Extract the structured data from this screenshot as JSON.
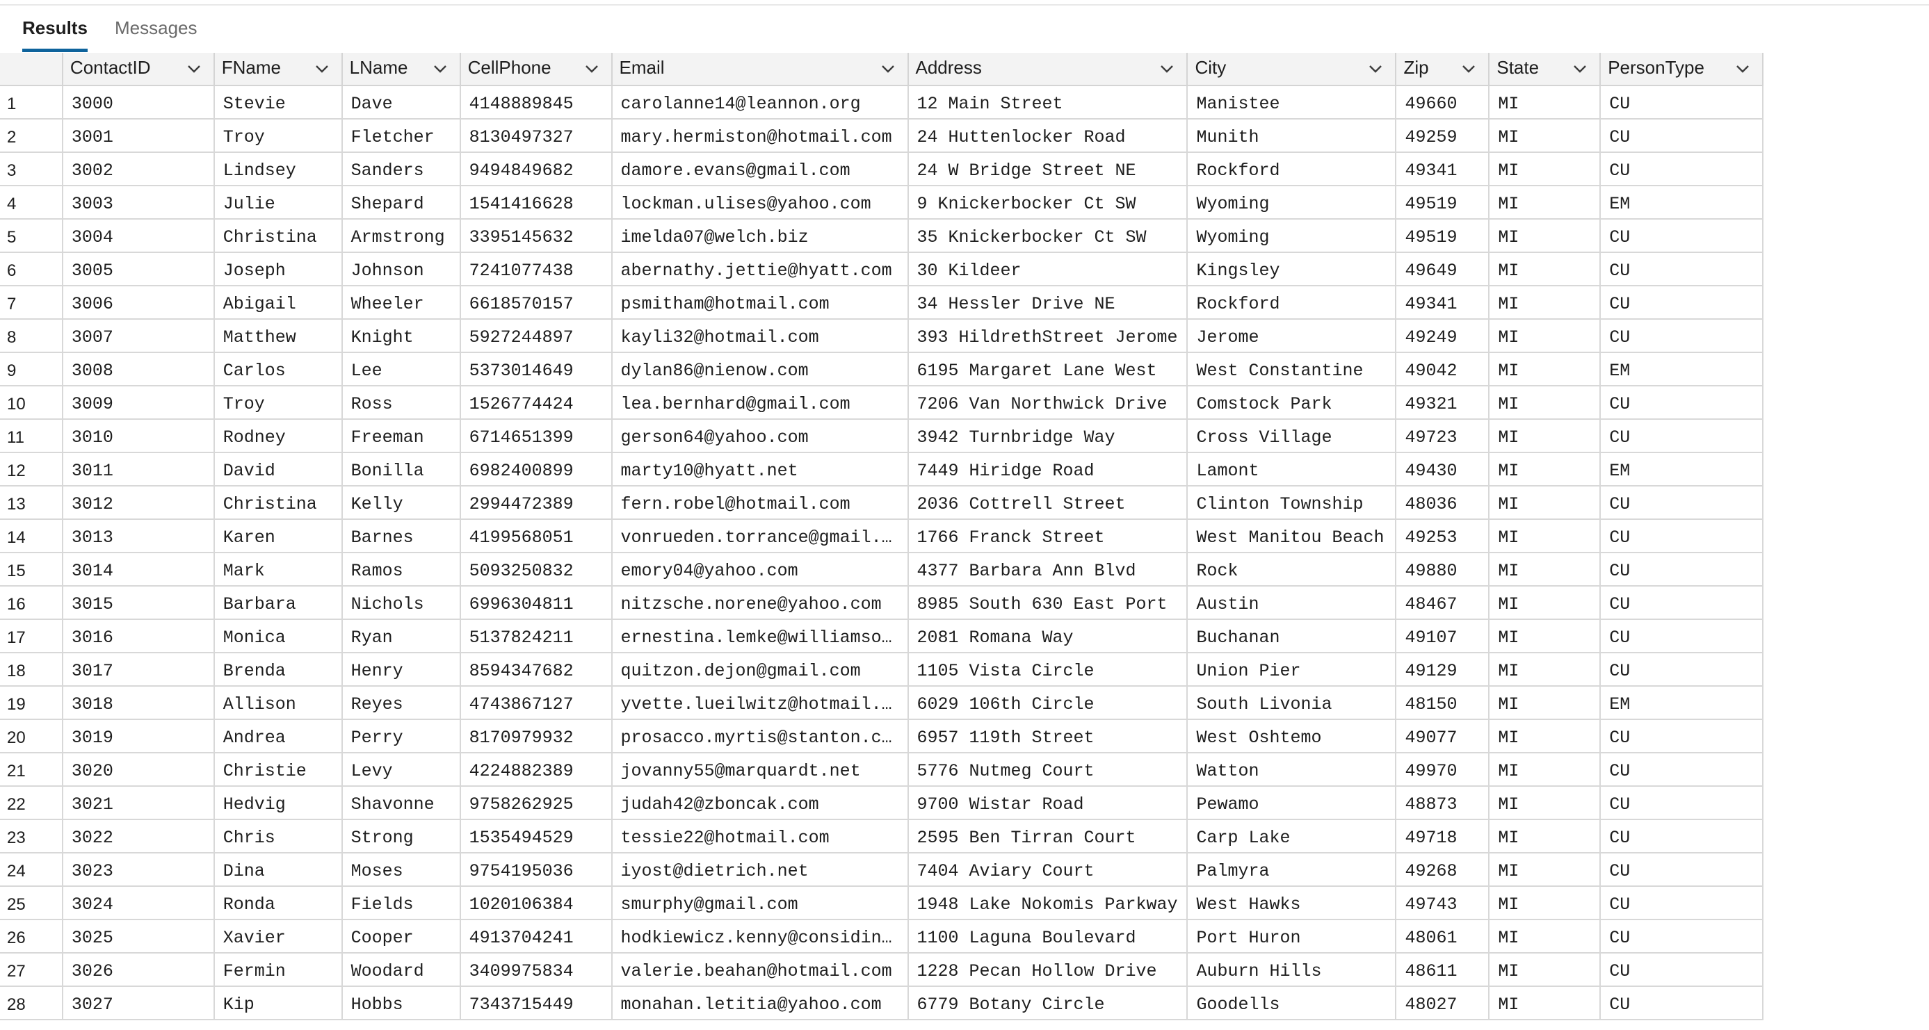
{
  "tabs": [
    {
      "label": "Results",
      "active": true
    },
    {
      "label": "Messages",
      "active": false
    }
  ],
  "columns": [
    "ContactID",
    "FName",
    "LName",
    "CellPhone",
    "Email",
    "Address",
    "City",
    "Zip",
    "State",
    "PersonType"
  ],
  "rows": [
    [
      "1",
      "3000",
      "Stevie",
      "Dave",
      "4148889845",
      "carolanne14@leannon.org",
      "12 Main Street",
      "Manistee",
      "49660",
      "MI",
      "CU"
    ],
    [
      "2",
      "3001",
      "Troy",
      "Fletcher",
      "8130497327",
      "mary.hermiston@hotmail.com",
      "24 Huttenlocker Road",
      "Munith",
      "49259",
      "MI",
      "CU"
    ],
    [
      "3",
      "3002",
      "Lindsey",
      "Sanders",
      "9494849682",
      "damore.evans@gmail.com",
      "24 W Bridge Street NE",
      "Rockford",
      "49341",
      "MI",
      "CU"
    ],
    [
      "4",
      "3003",
      "Julie",
      "Shepard",
      "1541416628",
      "lockman.ulises@yahoo.com",
      "9 Knickerbocker Ct SW",
      "Wyoming",
      "49519",
      "MI",
      "EM"
    ],
    [
      "5",
      "3004",
      "Christina",
      "Armstrong",
      "3395145632",
      "imelda07@welch.biz",
      "35 Knickerbocker Ct SW",
      "Wyoming",
      "49519",
      "MI",
      "CU"
    ],
    [
      "6",
      "3005",
      "Joseph",
      "Johnson",
      "7241077438",
      "abernathy.jettie@hyatt.com",
      "30 Kildeer",
      "Kingsley",
      "49649",
      "MI",
      "CU"
    ],
    [
      "7",
      "3006",
      "Abigail",
      "Wheeler",
      "6618570157",
      "psmitham@hotmail.com",
      "34 Hessler Drive NE",
      "Rockford",
      "49341",
      "MI",
      "CU"
    ],
    [
      "8",
      "3007",
      "Matthew",
      "Knight",
      "5927244897",
      "kayli32@hotmail.com",
      "393 HildrethStreet Jerome",
      "Jerome",
      "49249",
      "MI",
      "CU"
    ],
    [
      "9",
      "3008",
      "Carlos",
      "Lee",
      "5373014649",
      "dylan86@nienow.com",
      "6195 Margaret Lane West",
      "West Constantine",
      "49042",
      "MI",
      "EM"
    ],
    [
      "10",
      "3009",
      "Troy",
      "Ross",
      "1526774424",
      "lea.bernhard@gmail.com",
      "7206 Van Northwick Drive",
      "Comstock Park",
      "49321",
      "MI",
      "CU"
    ],
    [
      "11",
      "3010",
      "Rodney",
      "Freeman",
      "6714651399",
      "gerson64@yahoo.com",
      "3942 Turnbridge Way",
      "Cross Village",
      "49723",
      "MI",
      "CU"
    ],
    [
      "12",
      "3011",
      "David",
      "Bonilla",
      "6982400899",
      "marty10@hyatt.net",
      "7449 Hiridge Road",
      "Lamont",
      "49430",
      "MI",
      "EM"
    ],
    [
      "13",
      "3012",
      "Christina",
      "Kelly",
      "2994472389",
      "fern.robel@hotmail.com",
      "2036 Cottrell Street",
      "Clinton Township",
      "48036",
      "MI",
      "CU"
    ],
    [
      "14",
      "3013",
      "Karen",
      "Barnes",
      "4199568051",
      "vonrueden.torrance@gmail.…",
      "1766 Franck Street",
      "West Manitou Beach",
      "49253",
      "MI",
      "CU"
    ],
    [
      "15",
      "3014",
      "Mark",
      "Ramos",
      "5093250832",
      "emory04@yahoo.com",
      "4377 Barbara Ann Blvd",
      "Rock",
      "49880",
      "MI",
      "CU"
    ],
    [
      "16",
      "3015",
      "Barbara",
      "Nichols",
      "6996304811",
      "nitzsche.norene@yahoo.com",
      "8985 South 630 East Port",
      "Austin",
      "48467",
      "MI",
      "CU"
    ],
    [
      "17",
      "3016",
      "Monica",
      "Ryan",
      "5137824211",
      "ernestina.lemke@williamso…",
      "2081 Romana Way",
      "Buchanan",
      "49107",
      "MI",
      "CU"
    ],
    [
      "18",
      "3017",
      "Brenda",
      "Henry",
      "8594347682",
      "quitzon.dejon@gmail.com",
      "1105 Vista Circle",
      "Union Pier",
      "49129",
      "MI",
      "CU"
    ],
    [
      "19",
      "3018",
      "Allison",
      "Reyes",
      "4743867127",
      "yvette.lueilwitz@hotmail.…",
      "6029 106th Circle",
      "South Livonia",
      "48150",
      "MI",
      "EM"
    ],
    [
      "20",
      "3019",
      "Andrea",
      "Perry",
      "8170979932",
      "prosacco.myrtis@stanton.c…",
      "6957 119th Street",
      "West Oshtemo",
      "49077",
      "MI",
      "CU"
    ],
    [
      "21",
      "3020",
      "Christie",
      "Levy",
      "4224882389",
      "jovanny55@marquardt.net",
      "5776 Nutmeg Court",
      "Watton",
      "49970",
      "MI",
      "CU"
    ],
    [
      "22",
      "3021",
      "Hedvig",
      "Shavonne",
      "9758262925",
      "judah42@zboncak.com",
      "9700 Wistar Road",
      "Pewamo",
      "48873",
      "MI",
      "CU"
    ],
    [
      "23",
      "3022",
      "Chris",
      "Strong",
      "1535494529",
      "tessie22@hotmail.com",
      "2595 Ben Tirran Court",
      "Carp Lake",
      "49718",
      "MI",
      "CU"
    ],
    [
      "24",
      "3023",
      "Dina",
      "Moses",
      "9754195036",
      "iyost@dietrich.net",
      "7404 Aviary Court",
      "Palmyra",
      "49268",
      "MI",
      "CU"
    ],
    [
      "25",
      "3024",
      "Ronda",
      "Fields",
      "1020106384",
      "smurphy@gmail.com",
      "1948 Lake Nokomis Parkway",
      "West Hawks",
      "49743",
      "MI",
      "CU"
    ],
    [
      "26",
      "3025",
      "Xavier",
      "Cooper",
      "4913704241",
      "hodkiewicz.kenny@considin…",
      "1100 Laguna Boulevard",
      "Port Huron",
      "48061",
      "MI",
      "CU"
    ],
    [
      "27",
      "3026",
      "Fermin",
      "Woodard",
      "3409975834",
      "valerie.beahan@hotmail.com",
      "1228 Pecan Hollow Drive",
      "Auburn Hills",
      "48611",
      "MI",
      "CU"
    ],
    [
      "28",
      "3027",
      "Kip",
      "Hobbs",
      "7343715449",
      "monahan.letitia@yahoo.com",
      "6779 Botany Circle",
      "Goodells",
      "48027",
      "MI",
      "CU"
    ]
  ],
  "colors": {
    "accent": "#0e639c",
    "header_bg": "#f3f3f3",
    "grid_line": "#d8d8d8"
  },
  "icons": {
    "column_menu": "chevron-down-icon"
  }
}
